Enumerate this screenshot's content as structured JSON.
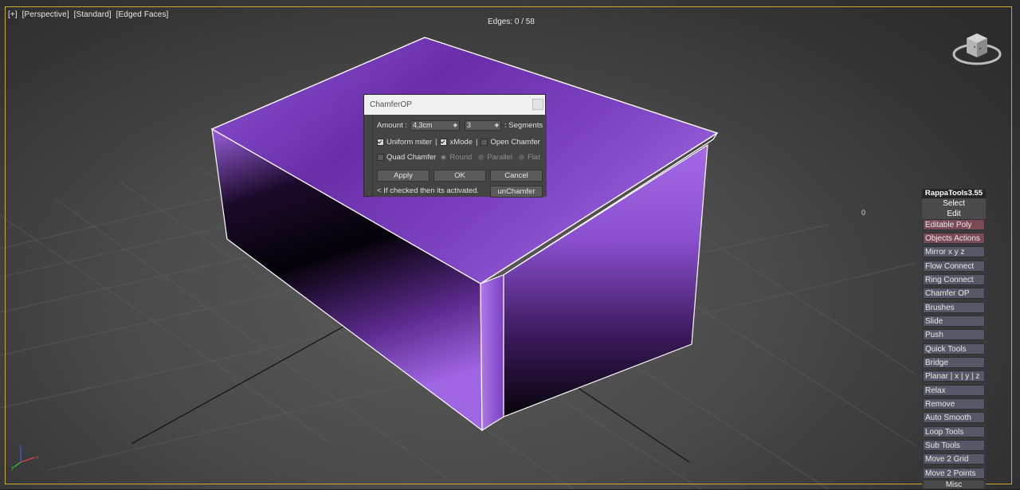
{
  "viewport": {
    "labels": [
      "[+]",
      "[Perspective]",
      "[Standard]",
      "[Edged Faces]"
    ],
    "edges_readout": "Edges: 0 / 58",
    "coord_text": "0"
  },
  "colors": {
    "accent_border": "#c9a83a",
    "box_purple": "#8a4fc9",
    "panel_item": "#575767",
    "panel_item_active": "#7a4a55"
  },
  "viewcube": {
    "icon": "viewcube-icon"
  },
  "axis_gizmo": {
    "icon": "axis-tripod-icon",
    "axes": [
      "x",
      "y",
      "z"
    ]
  },
  "chamfer_dialog": {
    "title": "ChamferOP",
    "amount_label": "Amount :",
    "amount_value": "4,3cm",
    "segments_value": "3",
    "segments_label": ": Segments",
    "uniform_miter": {
      "label": "Uniform miter",
      "checked": true
    },
    "xmode": {
      "label": "xMode",
      "checked": true
    },
    "open_chamfer": {
      "label": "Open Chamfer",
      "checked": false
    },
    "quad_chamfer": {
      "label": "Quad Chamfer",
      "checked": false
    },
    "radio_options": [
      {
        "label": "Round",
        "selected": true
      },
      {
        "label": "Parallel",
        "selected": false
      },
      {
        "label": "Flat",
        "selected": false
      }
    ],
    "apply_label": "Apply",
    "ok_label": "OK",
    "cancel_label": "Cancel",
    "hint_text": "< If checked then its activated.",
    "unchamfer_label": "unChamfer"
  },
  "rappa_tools": {
    "title": "RappaTools3.55",
    "select_label": "Select",
    "edit_label": "Edit",
    "items": [
      "Editable Poly",
      "Objects Actions",
      "Mirror   x  y  z",
      "Flow Connect",
      "Ring Connect",
      "Chamfer OP",
      "Brushes",
      "Slide",
      "Push",
      "Quick Tools",
      "Bridge",
      "Planar | x | y | z",
      "Relax",
      "Remove",
      "Auto Smooth",
      "Loop Tools",
      "Sub Tools",
      "Move 2 Grid",
      "Move 2 Points"
    ],
    "misc_label": "Misc"
  }
}
